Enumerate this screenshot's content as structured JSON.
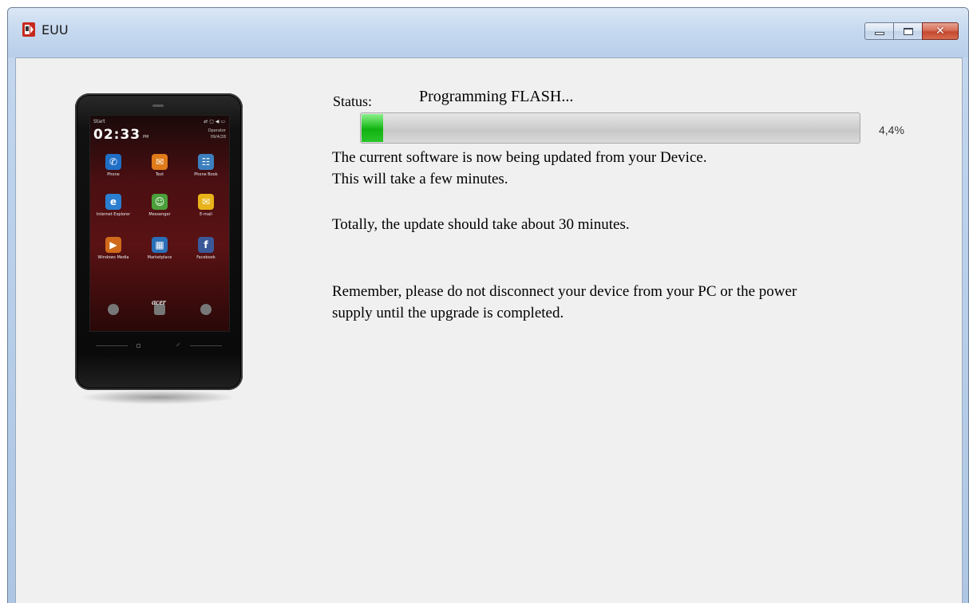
{
  "window": {
    "title": "EUU"
  },
  "phone": {
    "status_left": "Start",
    "status_right": "⇄ ▢ ◀ ▭",
    "time": "02:33",
    "ampm": "PM",
    "operator": "Operator",
    "date": "09/4/28",
    "brand": "acer",
    "tiles": [
      {
        "label": "Phone",
        "icon": "phone-icon",
        "color": "#1f6fc7"
      },
      {
        "label": "Text",
        "icon": "text-bubble-icon",
        "color": "#e07b1a"
      },
      {
        "label": "Phone Book",
        "icon": "contacts-icon",
        "color": "#3c7fbf"
      },
      {
        "label": "Internet Explorer",
        "icon": "internet-explorer-icon",
        "color": "#2a7fd1"
      },
      {
        "label": "Messenger",
        "icon": "messenger-icon",
        "color": "#4a9f3a"
      },
      {
        "label": "E-mail",
        "icon": "email-icon",
        "color": "#e8b31a"
      },
      {
        "label": "Windows Media",
        "icon": "media-icon",
        "color": "#d06a1a"
      },
      {
        "label": "Marketplace",
        "icon": "marketplace-icon",
        "color": "#2a6fb8"
      },
      {
        "label": "Facebook",
        "icon": "facebook-icon",
        "color": "#3b5998"
      }
    ]
  },
  "status": {
    "label": "Status:",
    "value": "Programming FLASH...",
    "progress_percent": 4.4,
    "percent_text": "4,4%"
  },
  "messages": {
    "line1": "The current software is now being updated from your Device.",
    "line2": "This will take a few minutes.",
    "line3": "Totally, the update should take about 30 minutes.",
    "line4": "Remember, please do not disconnect your device from your PC or the power",
    "line5": "supply until the upgrade is completed."
  },
  "colors": {
    "progress_green": "#12b212",
    "close_button": "#c5492f"
  }
}
